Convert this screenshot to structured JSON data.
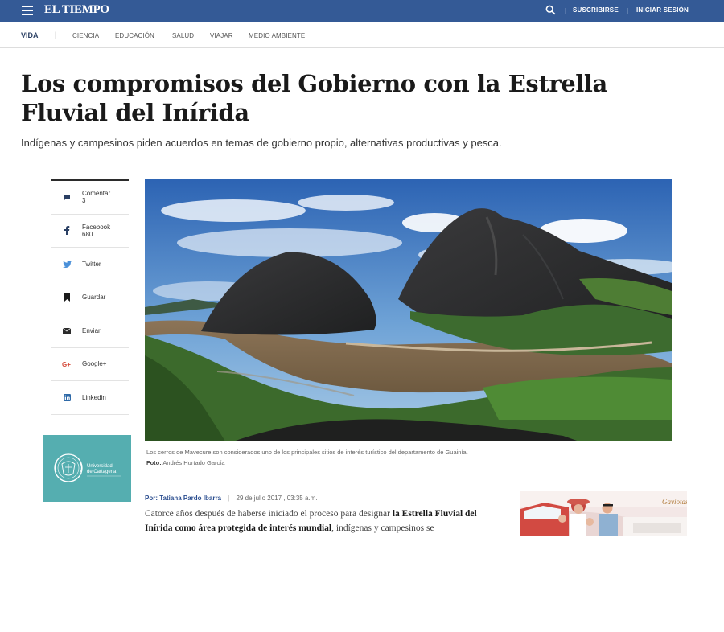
{
  "header": {
    "logo": "EL TIEMPO",
    "subscribe": "SUSCRIBIRSE",
    "login": "INICIAR SESIÓN"
  },
  "subnav": {
    "section": "VIDA",
    "items": [
      "CIENCIA",
      "EDUCACIÓN",
      "SALUD",
      "VIAJAR",
      "MEDIO AMBIENTE"
    ]
  },
  "article": {
    "title": "Los compromisos del Gobierno con la Estrella Fluvial del Inírida",
    "subtitle": "Indígenas y campesinos piden acuerdos en temas de gobierno propio, alternativas productivas y pesca.",
    "caption": "Los cerros de Mavecure son considerados uno de los principales sitios de interés turístico del departamento de Guainía.",
    "photo_credit_label": "Foto:",
    "photo_credit": "Andrés Hurtado García",
    "byline_prefix": "Por:",
    "author": "Tatiana Pardo Ibarra",
    "date": "29 de julio 2017 , 03:35 a.m.",
    "body_start": "Catorce años después de haberse iniciado el proceso para designar ",
    "body_bold": "la Estrella Fluvial del Inírida como área protegida de interés mundial",
    "body_end": ", indígenas y campesinos se"
  },
  "share": {
    "items": [
      {
        "label": "Comentar",
        "count": "3",
        "icon": "comment-icon"
      },
      {
        "label": "Facebook",
        "count": "680",
        "icon": "facebook-icon"
      },
      {
        "label": "Twitter",
        "count": "",
        "icon": "twitter-icon"
      },
      {
        "label": "Guardar",
        "count": "",
        "icon": "bookmark-icon"
      },
      {
        "label": "Enviar",
        "count": "",
        "icon": "envelope-icon"
      },
      {
        "label": "Google+",
        "count": "",
        "icon": "google-plus-icon"
      },
      {
        "label": "Linkedin",
        "count": "",
        "icon": "linkedin-icon"
      }
    ]
  },
  "promo": {
    "line1": "Universidad",
    "line2": "de Cartagena"
  },
  "ad": {
    "brand": "Gaviotas"
  },
  "colors": {
    "topbar": "#345a96",
    "promo": "#55aeb0",
    "accent_link": "#2a4d8f"
  }
}
